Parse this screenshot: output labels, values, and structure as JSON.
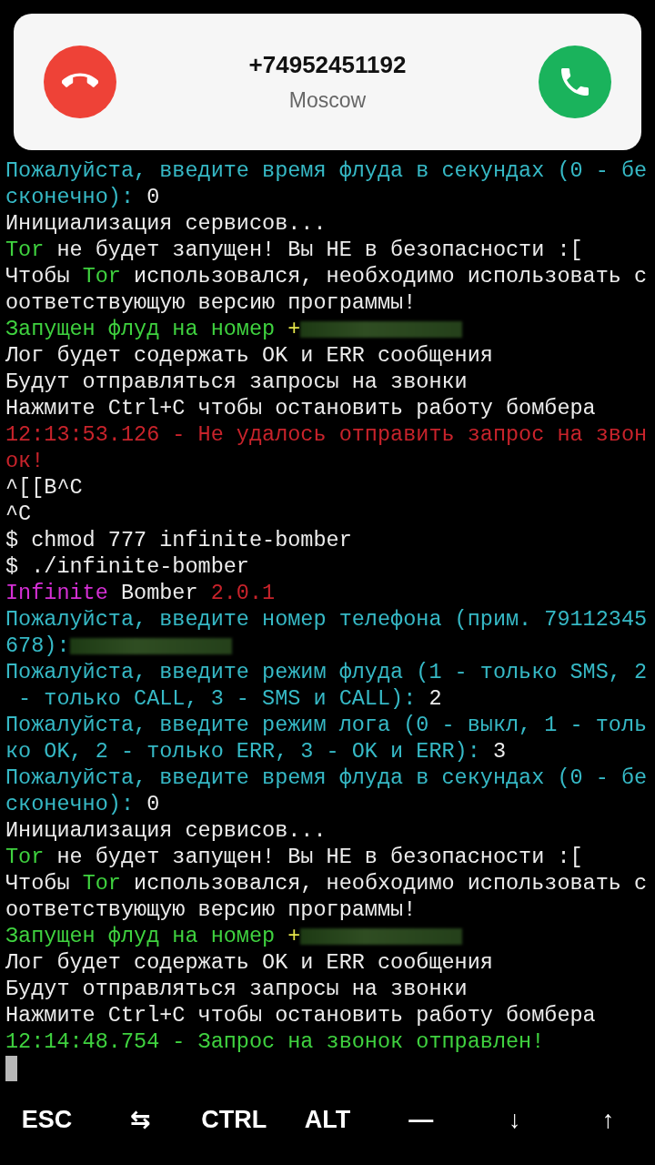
{
  "incoming_call": {
    "number": "+74952451192",
    "location": "Moscow"
  },
  "terminal": {
    "lines": [
      {
        "segments": [
          {
            "kind": "text",
            "text": "Пожалуйста, введите время флуда в секундах (0 - бе",
            "color": "#36b9c6"
          }
        ]
      },
      {
        "segments": [
          {
            "kind": "text",
            "text": "сконечно): ",
            "color": "#36b9c6"
          },
          {
            "kind": "text",
            "text": "0",
            "color": "#ececec"
          }
        ]
      },
      {
        "segments": [
          {
            "kind": "text",
            "text": "Инициализация сервисов...",
            "color": "#ececec"
          }
        ]
      },
      {
        "segments": [
          {
            "kind": "text",
            "text": "Tor",
            "color": "#3fd23f"
          },
          {
            "kind": "text",
            "text": " не будет запущен! Вы НЕ в безопасности :[",
            "color": "#ececec"
          }
        ]
      },
      {
        "segments": [
          {
            "kind": "text",
            "text": "Чтобы ",
            "color": "#ececec"
          },
          {
            "kind": "text",
            "text": "Tor",
            "color": "#3fd23f"
          },
          {
            "kind": "text",
            "text": " использовался, необходимо использовать с",
            "color": "#ececec"
          }
        ]
      },
      {
        "segments": [
          {
            "kind": "text",
            "text": "оответствующую версию программы!",
            "color": "#ececec"
          }
        ]
      },
      {
        "segments": [
          {
            "kind": "text",
            "text": "Запущен флуд на номер ",
            "color": "#3fd23f"
          },
          {
            "kind": "text",
            "text": "+",
            "color": "#e6e64a"
          },
          {
            "kind": "redacted"
          }
        ]
      },
      {
        "segments": [
          {
            "kind": "text",
            "text": "Лог будет содержать OK и ERR сообщения",
            "color": "#ececec"
          }
        ]
      },
      {
        "segments": [
          {
            "kind": "text",
            "text": "Будут отправляться запросы на звонки",
            "color": "#ececec"
          }
        ]
      },
      {
        "segments": [
          {
            "kind": "text",
            "text": "Нажмите Ctrl+C чтобы остановить работу бомбера",
            "color": "#ececec"
          }
        ]
      },
      {
        "segments": [
          {
            "kind": "text",
            "text": "12:13:53.126 - Не удалось отправить запрос на звон",
            "color": "#c8232b"
          }
        ]
      },
      {
        "segments": [
          {
            "kind": "text",
            "text": "ок!",
            "color": "#c8232b"
          }
        ]
      },
      {
        "segments": [
          {
            "kind": "text",
            "text": "^[[B^C",
            "color": "#ececec"
          }
        ]
      },
      {
        "segments": [
          {
            "kind": "text",
            "text": "^C",
            "color": "#ececec"
          }
        ]
      },
      {
        "segments": [
          {
            "kind": "text",
            "text": "$ chmod 777 infinite-bomber",
            "color": "#ececec"
          }
        ]
      },
      {
        "segments": [
          {
            "kind": "text",
            "text": "$ ./infinite-bomber",
            "color": "#ececec"
          }
        ]
      },
      {
        "segments": [
          {
            "kind": "text",
            "text": "Infinite",
            "color": "#d52fd5"
          },
          {
            "kind": "text",
            "text": " Bomber ",
            "color": "#ececec"
          },
          {
            "kind": "text",
            "text": "2.0.1",
            "color": "#c8232b"
          }
        ]
      },
      {
        "segments": [
          {
            "kind": "text",
            "text": "Пожалуйста, введите номер телефона (прим. 79112345",
            "color": "#36b9c6"
          }
        ]
      },
      {
        "segments": [
          {
            "kind": "text",
            "text": "678):",
            "color": "#36b9c6"
          },
          {
            "kind": "redacted"
          }
        ]
      },
      {
        "segments": [
          {
            "kind": "text",
            "text": "Пожалуйста, введите режим флуда (1 - только SMS, 2",
            "color": "#36b9c6"
          }
        ]
      },
      {
        "segments": [
          {
            "kind": "text",
            "text": " - только CALL, 3 - SMS и CALL): ",
            "color": "#36b9c6"
          },
          {
            "kind": "text",
            "text": "2",
            "color": "#ececec"
          }
        ]
      },
      {
        "segments": [
          {
            "kind": "text",
            "text": "Пожалуйста, введите режим лога (0 - выкл, 1 - толь",
            "color": "#36b9c6"
          }
        ]
      },
      {
        "segments": [
          {
            "kind": "text",
            "text": "ко OK, 2 - только ERR, 3 - OK и ERR): ",
            "color": "#36b9c6"
          },
          {
            "kind": "text",
            "text": "3",
            "color": "#ececec"
          }
        ]
      },
      {
        "segments": [
          {
            "kind": "text",
            "text": "Пожалуйста, введите время флуда в секундах (0 - бе",
            "color": "#36b9c6"
          }
        ]
      },
      {
        "segments": [
          {
            "kind": "text",
            "text": "сконечно): ",
            "color": "#36b9c6"
          },
          {
            "kind": "text",
            "text": "0",
            "color": "#ececec"
          }
        ]
      },
      {
        "segments": [
          {
            "kind": "text",
            "text": "Инициализация сервисов...",
            "color": "#ececec"
          }
        ]
      },
      {
        "segments": [
          {
            "kind": "text",
            "text": "Tor",
            "color": "#3fd23f"
          },
          {
            "kind": "text",
            "text": " не будет запущен! Вы НЕ в безопасности :[",
            "color": "#ececec"
          }
        ]
      },
      {
        "segments": [
          {
            "kind": "text",
            "text": "Чтобы ",
            "color": "#ececec"
          },
          {
            "kind": "text",
            "text": "Tor",
            "color": "#3fd23f"
          },
          {
            "kind": "text",
            "text": " использовался, необходимо использовать с",
            "color": "#ececec"
          }
        ]
      },
      {
        "segments": [
          {
            "kind": "text",
            "text": "оответствующую версию программы!",
            "color": "#ececec"
          }
        ]
      },
      {
        "segments": [
          {
            "kind": "text",
            "text": "Запущен флуд на номер ",
            "color": "#3fd23f"
          },
          {
            "kind": "text",
            "text": "+",
            "color": "#e6e64a"
          },
          {
            "kind": "redacted"
          }
        ]
      },
      {
        "segments": [
          {
            "kind": "text",
            "text": "Лог будет содержать OK и ERR сообщения",
            "color": "#ececec"
          }
        ]
      },
      {
        "segments": [
          {
            "kind": "text",
            "text": "Будут отправляться запросы на звонки",
            "color": "#ececec"
          }
        ]
      },
      {
        "segments": [
          {
            "kind": "text",
            "text": "Нажмите Ctrl+C чтобы остановить работу бомбера",
            "color": "#ececec"
          }
        ]
      },
      {
        "segments": [
          {
            "kind": "text",
            "text": "12:14:48.754 - Запрос на звонок отправлен!",
            "color": "#3fd23f"
          }
        ]
      }
    ]
  },
  "extra_keys": [
    "ESC",
    "⇆",
    "CTRL",
    "ALT",
    "—",
    "↓",
    "↑"
  ]
}
